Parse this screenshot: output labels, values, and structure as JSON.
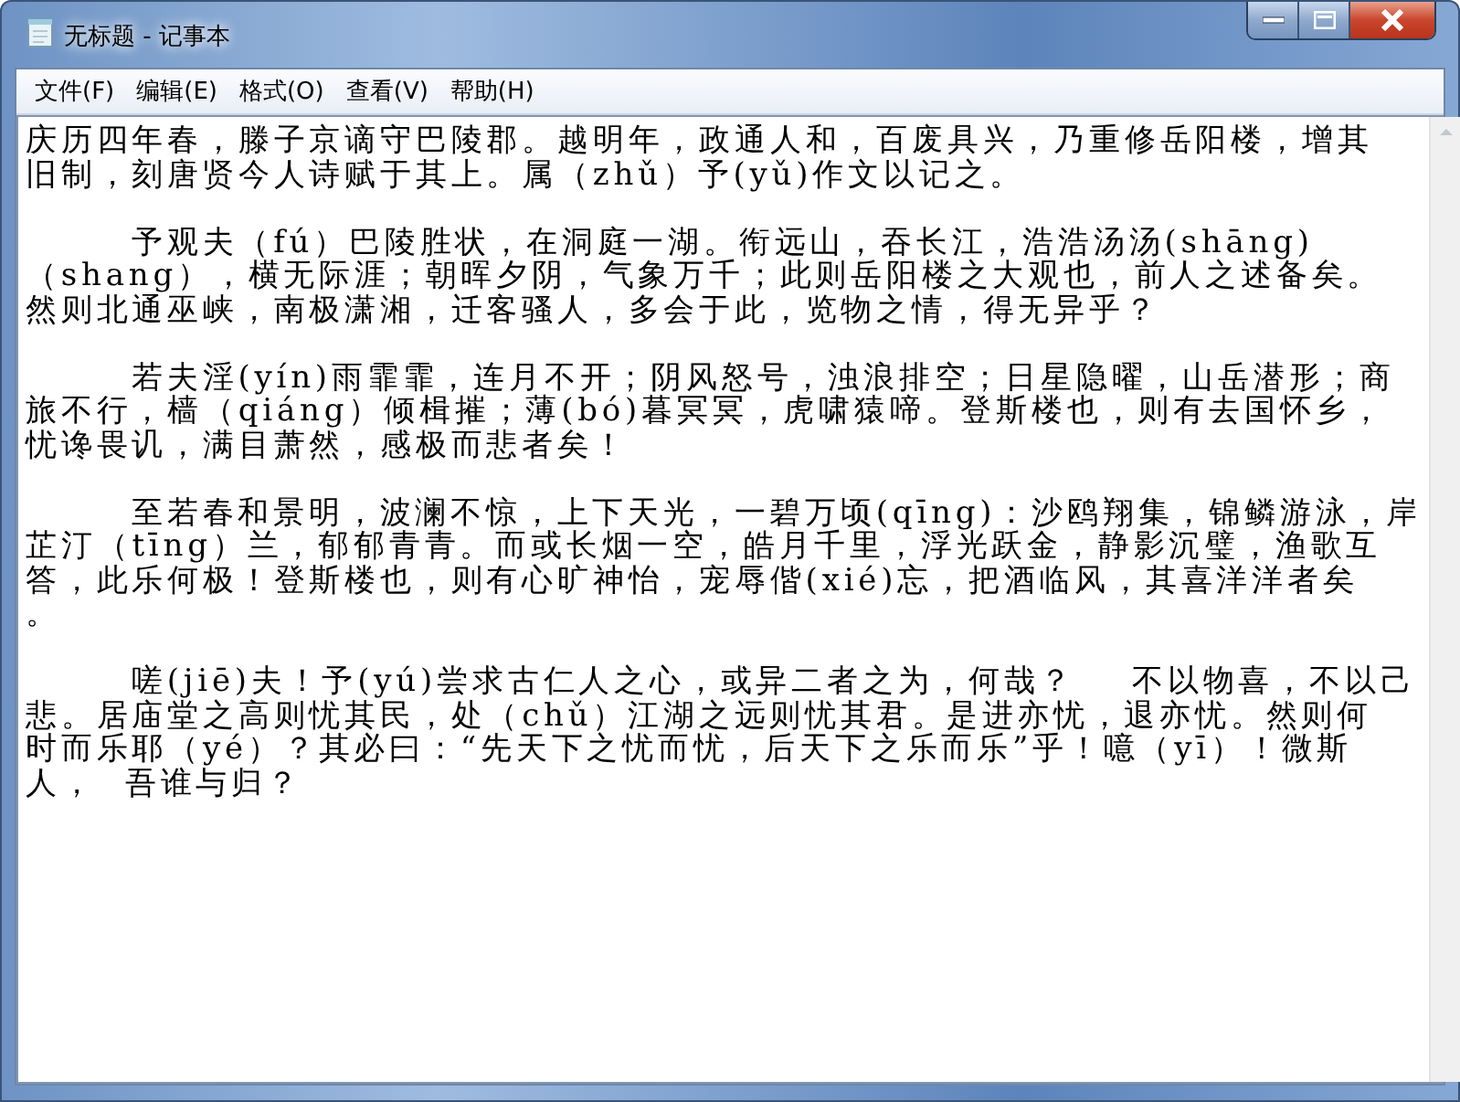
{
  "window": {
    "title": "无标题 - 记事本"
  },
  "menu": [
    "文件(F)",
    "编辑(E)",
    "格式(O)",
    "查看(V)",
    "帮助(H)"
  ],
  "document": {
    "paragraphs": [
      {
        "indented": false,
        "lines": [
          "庆历四年春，滕子京谪守巴陵郡。越明年，政通人和，百废具兴，乃重修岳阳楼，增其",
          "旧制，刻唐贤今人诗赋于其上。属（zhǔ）予(yǔ)作文以记之。"
        ]
      },
      {
        "indented": true,
        "lines": [
          "予观夫（fú）巴陵胜状，在洞庭一湖。衔远山，吞长江，浩浩汤汤(shāng)",
          "（shang），横无际涯；朝晖夕阴，气象万千；此则岳阳楼之大观也，前人之述备矣。",
          "然则北通巫峡，南极潇湘，迁客骚人，多会于此，览物之情，得无异乎？"
        ]
      },
      {
        "indented": true,
        "lines": [
          "若夫淫(yín)雨霏霏，连月不开；阴风怒号，浊浪排空；日星隐曜，山岳潜形；商",
          "旅不行，樯（qiáng）倾楫摧；薄(bó)暮冥冥，虎啸猿啼。登斯楼也，则有去国怀乡，",
          "忧谗畏讥，满目萧然，感极而悲者矣！"
        ]
      },
      {
        "indented": true,
        "lines": [
          "至若春和景明，波澜不惊，上下天光，一碧万顷(qīng)：沙鸥翔集，锦鳞游泳，岸",
          "芷汀（tīng）兰，郁郁青青。而或长烟一空，皓月千里，浮光跃金，静影沉璧，渔歌互",
          "答，此乐何极！登斯楼也，则有心旷神怡，宠辱偕(xié)忘，把酒临风，其喜洋洋者矣",
          "。"
        ]
      },
      {
        "indented": true,
        "lines": [
          "嗟(jiē)夫！予(yú)尝求古仁人之心，或异二者之为，何哉？    不以物喜，不以己",
          "悲。居庙堂之高则忧其民，处（chǔ）江湖之远则忧其君。是进亦忧，退亦忧。然则何",
          "时而乐耶（yé）？其必曰：“先天下之忧而忧，后天下之乐而乐”乎！噫（yī）！微斯",
          "人，  吾谁与归？"
        ]
      }
    ]
  }
}
